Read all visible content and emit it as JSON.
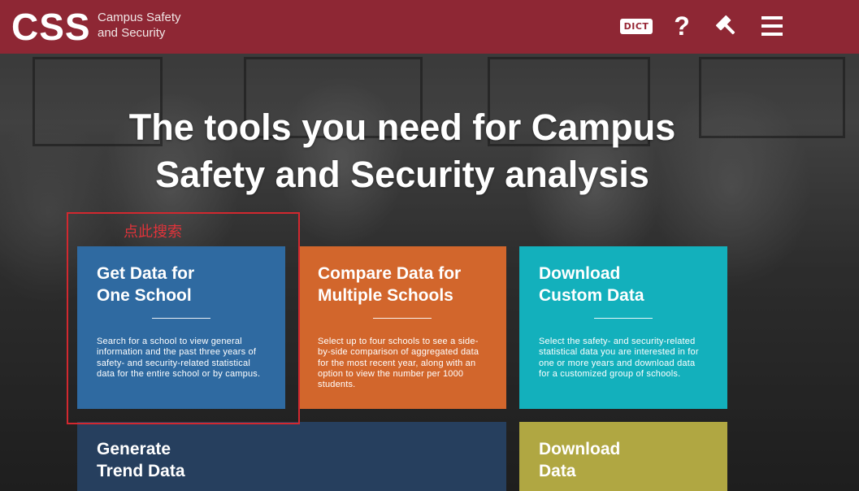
{
  "header": {
    "logo": "CSS",
    "logo_line1": "Campus Safety",
    "logo_line2": "and Security",
    "nav": {
      "dictionary_label": "DICT",
      "help_label": "?",
      "tools_icon": "hammer-icon",
      "menu_icon": "hamburger-menu-icon"
    },
    "brand_color": "#962634"
  },
  "hero": {
    "title_line1": "The tools you need for Campus",
    "title_line2": "Safety and Security analysis"
  },
  "annotation": {
    "label": "点此搜索",
    "color": "#d2282f"
  },
  "cards": [
    {
      "title": "Get Data for\nOne School",
      "description": "Search for a school to view general information and the past three years of safety- and security-related statistical data for the entire school or by campus.",
      "color": "#2f6aa1"
    },
    {
      "title": "Compare Data for\nMultiple Schools",
      "description": "Select up to four schools to see a side-by-side comparison of aggregated data for the most recent year, along with an option to view the number per 1000 students.",
      "color": "#d2662c"
    },
    {
      "title": "Download\nCustom Data",
      "description": "Select the safety- and security-related statistical data you are interested in for one or more years and download data for a customized group of schools.",
      "color": "#13b0bc"
    },
    {
      "title": "Generate\nTrend Data",
      "color": "#263f5e"
    },
    {
      "title": "Download\nData",
      "color": "#b0a742"
    }
  ]
}
